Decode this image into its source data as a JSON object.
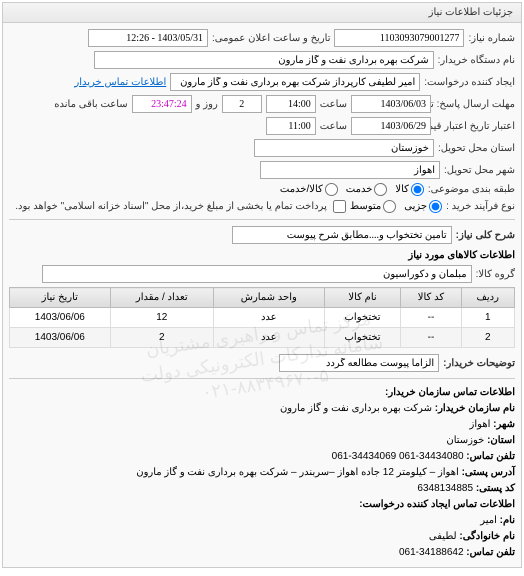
{
  "panel_title": "جزئیات اطلاعات نیاز",
  "fields": {
    "need_number_label": "شماره نیاز:",
    "need_number": "1103093079001277",
    "announce_datetime_label": "تاریخ و ساعت اعلان عمومی:",
    "announce_datetime": "1403/05/31 - 12:26",
    "buyer_org_label": "نام دستگاه خریدار:",
    "buyer_org": "شرکت بهره برداری نفت و گاز مارون",
    "request_creator_label": "ایجاد کننده درخواست:",
    "request_creator": "امیر لطیفی کارپرداز شرکت بهره برداری نفت و گاز مارون",
    "contact_link": "اطلاعات تماس خریدار",
    "response_from_label": "مهلت ارسال پاسخ: تا تاریخ:",
    "response_date": "1403/06/03",
    "response_time_label": "ساعت",
    "response_time": "14:00",
    "days_label": "روز و",
    "days_value": "2",
    "remaining_label": "ساعت باقی مانده",
    "remaining_time": "23:47:24",
    "validity_label": "اعتبار تاریخ اعتبار قیمت: تا تاریخ:",
    "validity_date": "1403/06/29",
    "validity_time": "11:00",
    "province_label": "استان محل تحویل:",
    "province": "خوزستان",
    "city_label": "شهر محل تحویل:",
    "city": "اهواز",
    "budget_class_label": "طبقه بندی موضوعی:",
    "budget_kala": "کالا",
    "budget_khadamat": "خدمت",
    "budget_kala_khadamat": "کالا/خدمت",
    "purchase_type_label": "نوع فرآیند خرید :",
    "purchase_jozi": "جزیی",
    "purchase_motavaset": "متوسط",
    "purchase_note": "پرداخت تمام یا بخشی از مبلغ خرید،از محل \"اسناد خزانه اسلامی\" خواهد بود.",
    "need_desc_label": "شرح کلی نیاز:",
    "need_desc": "تامین تختخواب و....مطابق شرح پیوست",
    "items_section_title": "اطلاعات کالاهای مورد نیاز",
    "group_label": "گروه کالا:",
    "group_value": "مبلمان و دکوراسیون",
    "buyer_note_label": "توضیحات خریدار:",
    "buyer_note": "الزاما پیوست مطالعه گردد",
    "contact_section_title": "اطلاعات تماس سازمان خریدار:",
    "org_name_label": "نام سازمان خریدار:",
    "org_name": "شرکت بهره برداری نفت و گاز مارون",
    "org_city_label": "شهر:",
    "org_city": "اهواز",
    "org_province_label": "استان:",
    "org_province": "خوزستان",
    "org_phone_label": "تلفن تماس:",
    "org_phone": "34434080-061  34434069-061",
    "org_address_label": "آدرس پستی:",
    "org_address": "اهواز – کیلومتر 12 جاده اهواز –سربندر – شرکت بهره برداری نفت و گاز مارون",
    "org_postal_label": "کد پستی:",
    "org_postal": "6348134885",
    "creator_section_title": "اطلاعات تماس ایجاد کننده درخواست:",
    "creator_name_label": "نام:",
    "creator_name": "امیر",
    "creator_family_label": "نام خانوادگی:",
    "creator_family": "لطیفی",
    "creator_phone_label": "تلفن تماس:",
    "creator_phone": "34188642-061"
  },
  "table": {
    "headers": [
      "ردیف",
      "کد کالا",
      "نام کالا",
      "واحد شمارش",
      "تعداد / مقدار",
      "تاریخ نیاز"
    ],
    "rows": [
      [
        "1",
        "--",
        "تختخواب",
        "عدد",
        "12",
        "1403/06/06"
      ],
      [
        "2",
        "--",
        "تختخواب",
        "عدد",
        "2",
        "1403/06/06"
      ]
    ]
  },
  "watermark": {
    "line1": "مرکز تماس و راهبری مشتریان",
    "line2": "سامانه تدارکات الکترونیکی دولت",
    "line3": "۰۲۱-۸۸۳۴۹۶۷۰-۵"
  }
}
